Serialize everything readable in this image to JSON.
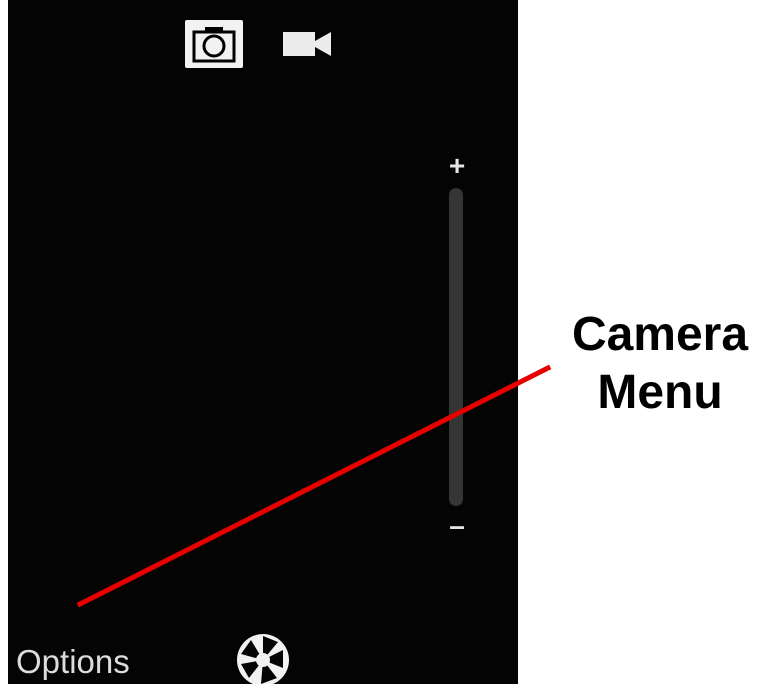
{
  "screen": {
    "mode_switch": {
      "photo_icon": "camera-icon",
      "video_icon": "video-camera-icon"
    },
    "zoom": {
      "plus_label": "+",
      "minus_label": "–"
    },
    "bottom_bar": {
      "options_label": "Options",
      "shutter_icon": "aperture-icon"
    }
  },
  "annotation": {
    "line1": "Camera",
    "line2": "Menu",
    "line_color": "#e60000"
  },
  "colors": {
    "screen_background": "#050404",
    "zoom_track": "#363535",
    "photo_mode_background": "#f2f2f2"
  }
}
